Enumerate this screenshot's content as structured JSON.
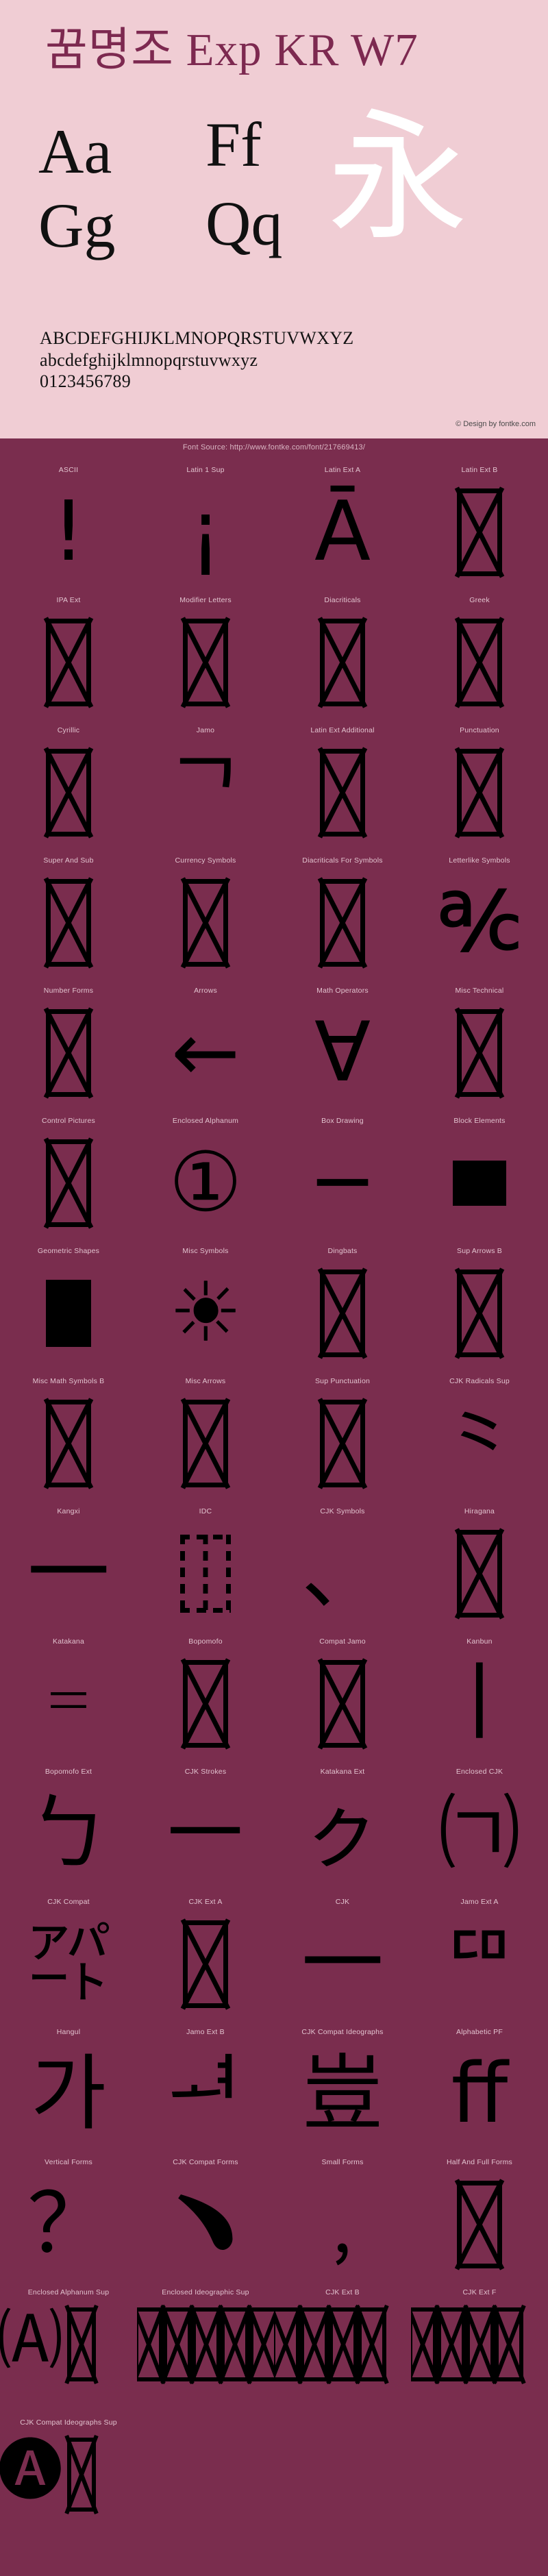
{
  "colors": {
    "header_bg": "#f0cdd4",
    "body_bg": "#7a2d4e",
    "title_color": "#7d2950",
    "label_color": "#e2c3cf",
    "glyph_color": "#000000",
    "cjk_watermark_color": "#ffffff"
  },
  "header": {
    "font_title": "꿈명조 Exp KR W7",
    "samples": [
      {
        "id": "aa",
        "text": "Aa"
      },
      {
        "id": "ff",
        "text": "Ff"
      },
      {
        "id": "gg",
        "text": "Gg"
      },
      {
        "id": "qq",
        "text": "Qq"
      }
    ],
    "cjk_watermark": "永",
    "charset": {
      "uppercase": "ABCDEFGHIJKLMNOPQRSTUVWXYZ",
      "lowercase": "abcdefghijklmnopqrstuvwxyz",
      "digits": "0123456789"
    },
    "design_credit": "© Design by fontke.com"
  },
  "source_bar": {
    "text": "Font Source: http://www.fontke.com/font/217669413/"
  },
  "unicode_blocks": [
    {
      "label": "ASCII",
      "glyph": "!",
      "kind": "char",
      "size": "glyph-big"
    },
    {
      "label": "Latin 1 Sup",
      "glyph": "¡",
      "kind": "char",
      "size": "glyph-big"
    },
    {
      "label": "Latin Ext A",
      "glyph": "Ā",
      "kind": "char",
      "size": "glyph-big"
    },
    {
      "label": "Latin Ext B",
      "glyph": "",
      "kind": "notdef",
      "size": ""
    },
    {
      "label": "IPA Ext",
      "glyph": "",
      "kind": "notdef",
      "size": ""
    },
    {
      "label": "Modifier Letters",
      "glyph": "",
      "kind": "notdef",
      "size": ""
    },
    {
      "label": "Diacriticals",
      "glyph": "",
      "kind": "notdef",
      "size": ""
    },
    {
      "label": "Greek",
      "glyph": "",
      "kind": "notdef",
      "size": ""
    },
    {
      "label": "Cyrillic",
      "glyph": "",
      "kind": "notdef",
      "size": ""
    },
    {
      "label": "Jamo",
      "glyph": "ᄀ",
      "kind": "char",
      "size": "glyph-big"
    },
    {
      "label": "Latin Ext Additional",
      "glyph": "",
      "kind": "notdef",
      "size": ""
    },
    {
      "label": "Punctuation",
      "glyph": "",
      "kind": "notdef",
      "size": ""
    },
    {
      "label": "Super And Sub",
      "glyph": "",
      "kind": "notdef",
      "size": ""
    },
    {
      "label": "Currency Symbols",
      "glyph": "",
      "kind": "notdef",
      "size": ""
    },
    {
      "label": "Diacriticals For Symbols",
      "glyph": "",
      "kind": "notdef",
      "size": ""
    },
    {
      "label": "Letterlike Symbols",
      "glyph": "℀",
      "kind": "char",
      "size": "glyph-big"
    },
    {
      "label": "Number Forms",
      "glyph": "",
      "kind": "notdef",
      "size": ""
    },
    {
      "label": "Arrows",
      "glyph": "←",
      "kind": "char",
      "size": "glyph-big"
    },
    {
      "label": "Math Operators",
      "glyph": "∀",
      "kind": "char",
      "size": "glyph-big"
    },
    {
      "label": "Misc Technical",
      "glyph": "",
      "kind": "notdef",
      "size": ""
    },
    {
      "label": "Control Pictures",
      "glyph": "",
      "kind": "notdef",
      "size": ""
    },
    {
      "label": "Enclosed Alphanum",
      "glyph": "①",
      "kind": "char",
      "size": "glyph-big"
    },
    {
      "label": "Box Drawing",
      "glyph": "─",
      "kind": "char",
      "size": "glyph-big"
    },
    {
      "label": "Block Elements",
      "glyph": "",
      "kind": "solid",
      "size": ""
    },
    {
      "label": "Geometric Shapes",
      "glyph": "",
      "kind": "solidtall",
      "size": ""
    },
    {
      "label": "Misc Symbols",
      "glyph": "☀",
      "kind": "char",
      "size": "glyph-big"
    },
    {
      "label": "Dingbats",
      "glyph": "",
      "kind": "notdef",
      "size": ""
    },
    {
      "label": "Sup Arrows B",
      "glyph": "",
      "kind": "notdef",
      "size": ""
    },
    {
      "label": "Misc Math Symbols B",
      "glyph": "",
      "kind": "notdef",
      "size": ""
    },
    {
      "label": "Misc Arrows",
      "glyph": "",
      "kind": "notdef",
      "size": ""
    },
    {
      "label": "Sup Punctuation",
      "glyph": "",
      "kind": "notdef",
      "size": ""
    },
    {
      "label": "CJK Radicals Sup",
      "glyph": "⺀",
      "kind": "char",
      "size": "glyph-big"
    },
    {
      "label": "Kangxi",
      "glyph": "一",
      "kind": "char",
      "size": "glyph-big"
    },
    {
      "label": "IDC",
      "glyph": "",
      "kind": "dashed",
      "size": ""
    },
    {
      "label": "CJK Symbols",
      "glyph": "、",
      "kind": "char",
      "size": "glyph-big"
    },
    {
      "label": "Hiragana",
      "glyph": "",
      "kind": "notdef",
      "size": ""
    },
    {
      "label": "Katakana",
      "glyph": "゠",
      "kind": "char",
      "size": "glyph-big"
    },
    {
      "label": "Bopomofo",
      "glyph": "",
      "kind": "notdef",
      "size": ""
    },
    {
      "label": "Compat Jamo",
      "glyph": "",
      "kind": "notdef",
      "size": ""
    },
    {
      "label": "Kanbun",
      "glyph": "丨",
      "kind": "char",
      "size": "glyph-big"
    },
    {
      "label": "Bopomofo Ext",
      "glyph": "ㄅ",
      "kind": "char",
      "size": "glyph-big"
    },
    {
      "label": "CJK Strokes",
      "glyph": "㇐",
      "kind": "char",
      "size": "glyph-big"
    },
    {
      "label": "Katakana Ext",
      "glyph": "ㇰ",
      "kind": "char",
      "size": "glyph-big"
    },
    {
      "label": "Enclosed CJK",
      "glyph": "㈀",
      "kind": "char",
      "size": "glyph-big"
    },
    {
      "label": "CJK Compat",
      "glyph": "㌀",
      "kind": "char",
      "size": "glyph-big"
    },
    {
      "label": "CJK Ext A",
      "glyph": "",
      "kind": "notdef",
      "size": ""
    },
    {
      "label": "CJK",
      "glyph": "一",
      "kind": "char",
      "size": "glyph-big"
    },
    {
      "label": "Jamo Ext A",
      "glyph": "ꥠ",
      "kind": "char",
      "size": "glyph-big"
    },
    {
      "label": "Hangul",
      "glyph": "가",
      "kind": "char",
      "size": "glyph-big"
    },
    {
      "label": "Jamo Ext B",
      "glyph": "ힰ",
      "kind": "char",
      "size": "glyph-big"
    },
    {
      "label": "CJK Compat Ideographs",
      "glyph": "豈",
      "kind": "char",
      "size": "glyph-big"
    },
    {
      "label": "Alphabetic PF",
      "glyph": "ﬀ",
      "kind": "char",
      "size": "glyph-big"
    },
    {
      "label": "Vertical Forms",
      "glyph": "？",
      "kind": "char",
      "size": "glyph-big"
    },
    {
      "label": "CJK Compat Forms",
      "glyph": "﹅",
      "kind": "char",
      "size": "glyph-big"
    },
    {
      "label": "Small Forms",
      "glyph": "﹐",
      "kind": "char",
      "size": "glyph-big"
    },
    {
      "label": "Half And Full Forms",
      "glyph": "",
      "kind": "notdef",
      "size": ""
    },
    {
      "label": "Enclosed Alphanum Sup",
      "glyph": "🄐",
      "kind": "dense2",
      "size": ""
    },
    {
      "label": "Enclosed Ideographic Sup",
      "glyph": "",
      "kind": "dense9",
      "size": ""
    },
    {
      "label": "CJK Ext B",
      "glyph": "",
      "kind": "densecont",
      "size": ""
    },
    {
      "label": "CJK Ext F",
      "glyph": "",
      "kind": "densecont",
      "size": ""
    },
    {
      "label": "CJK Compat Ideographs Sup",
      "glyph": "🅐",
      "kind": "lastpair",
      "size": ""
    }
  ]
}
